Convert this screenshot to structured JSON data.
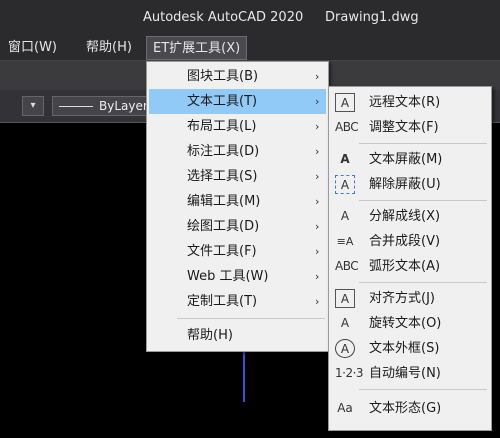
{
  "window": {
    "app_title": "Autodesk AutoCAD 2020",
    "document": "Drawing1.dwg"
  },
  "menubar": {
    "window": "窗口(W)",
    "help": "帮助(H)",
    "et": "ET扩展工具(X)"
  },
  "toolbar": {
    "linetype": "ByLayer"
  },
  "et_menu": {
    "items": [
      {
        "label": "图块工具(B)",
        "submenu": true
      },
      {
        "label": "文本工具(T)",
        "submenu": true,
        "highlighted": true
      },
      {
        "label": "布局工具(L)",
        "submenu": true
      },
      {
        "label": "标注工具(D)",
        "submenu": true
      },
      {
        "label": "选择工具(S)",
        "submenu": true
      },
      {
        "label": "编辑工具(M)",
        "submenu": true
      },
      {
        "label": "绘图工具(D)",
        "submenu": true
      },
      {
        "label": "文件工具(F)",
        "submenu": true
      },
      {
        "label": "Web 工具(W)",
        "submenu": true
      },
      {
        "label": "定制工具(T)",
        "submenu": true
      }
    ],
    "help": "帮助(H)",
    "highlight_color": "#91c9f7"
  },
  "text_submenu": {
    "items": [
      {
        "label": "远程文本(R)",
        "icon": "remote-text-icon"
      },
      {
        "label": "调整文本(F)",
        "icon": "adjust-text-icon"
      },
      {
        "label": "文本屏蔽(M)",
        "icon": "text-mask-icon"
      },
      {
        "label": "解除屏蔽(U)",
        "icon": "unmask-text-icon"
      },
      {
        "label": "分解成线(X)",
        "icon": "explode-text-icon"
      },
      {
        "label": "合并成段(V)",
        "icon": "merge-paragraph-icon"
      },
      {
        "label": "弧形文本(A)",
        "icon": "arc-text-icon"
      },
      {
        "label": "对齐方式(J)",
        "icon": "justify-text-icon"
      },
      {
        "label": "旋转文本(O)",
        "icon": "rotate-text-icon"
      },
      {
        "label": "文本外框(S)",
        "icon": "text-frame-icon"
      },
      {
        "label": "自动编号(N)",
        "icon": "auto-number-icon"
      },
      {
        "label": "文本形态(G)",
        "icon": "text-case-icon"
      }
    ]
  },
  "icon_glyphs": {
    "remote": "A",
    "adjust": "ABC",
    "mask": "A",
    "unmask": "A",
    "explode": "A",
    "merge": "≡A",
    "arc": "ABC",
    "justify": "A",
    "rotate": "A",
    "frame": "A",
    "number": "1·2·3",
    "case": "Aa"
  }
}
